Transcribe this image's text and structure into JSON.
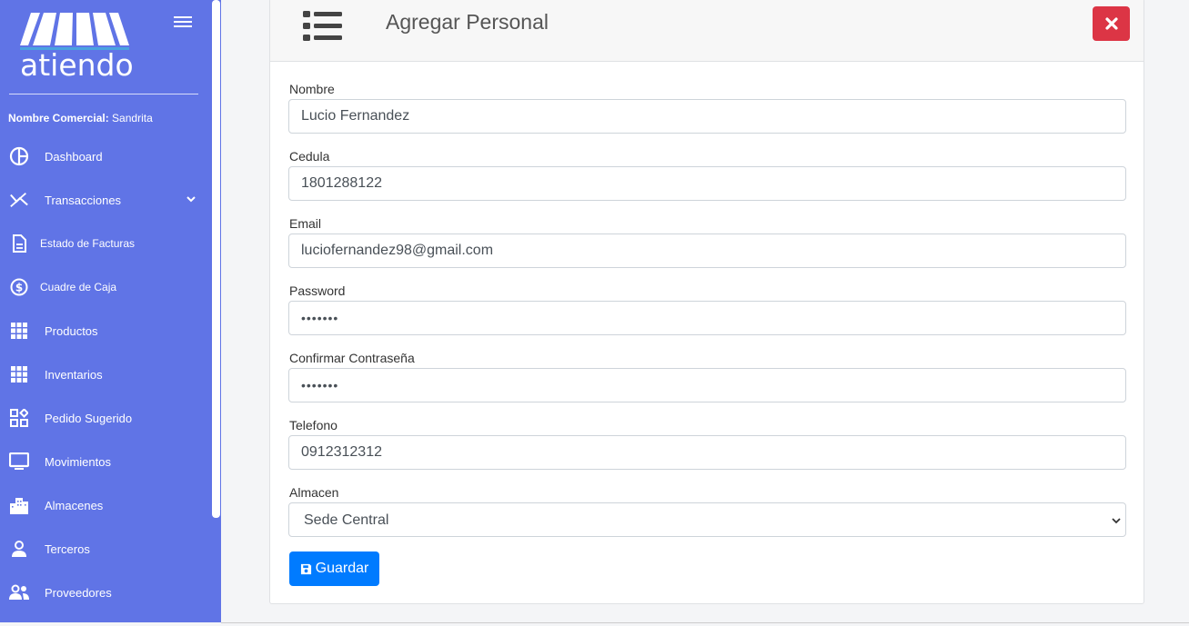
{
  "app": {
    "logo_text": "atiendo",
    "colors": {
      "sidebar": "#6074e6",
      "primary": "#007bff",
      "danger": "#dc3545"
    }
  },
  "sidebar": {
    "commercial_label": "Nombre Comercial:",
    "commercial_value": "Sandrita",
    "items": [
      {
        "label": "Dashboard",
        "icon": "dashboard-pie-icon"
      },
      {
        "label": "Transacciones",
        "icon": "transactions-icon",
        "has_submenu": true
      },
      {
        "label": "Estado de Facturas",
        "icon": "invoice-document-icon"
      },
      {
        "label": "Cuadre de Caja",
        "icon": "dollar-circle-icon"
      },
      {
        "label": "Productos",
        "icon": "grid-icon"
      },
      {
        "label": "Inventarios",
        "icon": "grid-icon"
      },
      {
        "label": "Pedido Sugerido",
        "icon": "widgets-icon"
      },
      {
        "label": "Movimientos",
        "icon": "monitor-icon"
      },
      {
        "label": "Almacenes",
        "icon": "buildings-icon"
      },
      {
        "label": "Terceros",
        "icon": "person-icon"
      },
      {
        "label": "Proveedores",
        "icon": "people-icon"
      }
    ]
  },
  "form": {
    "title": "Agregar Personal",
    "fields": {
      "nombre": {
        "label": "Nombre",
        "value": "Lucio Fernandez"
      },
      "cedula": {
        "label": "Cedula",
        "value": "1801288122"
      },
      "email": {
        "label": "Email",
        "value": "luciofernandez98@gmail.com"
      },
      "password": {
        "label": "Password",
        "value": "•••••••"
      },
      "confirm": {
        "label": "Confirmar Contraseña",
        "value": "•••••••"
      },
      "telefono": {
        "label": "Telefono",
        "value": "0912312312"
      },
      "almacen": {
        "label": "Almacen",
        "value": "Sede Central"
      }
    },
    "save_label": "Guardar"
  }
}
